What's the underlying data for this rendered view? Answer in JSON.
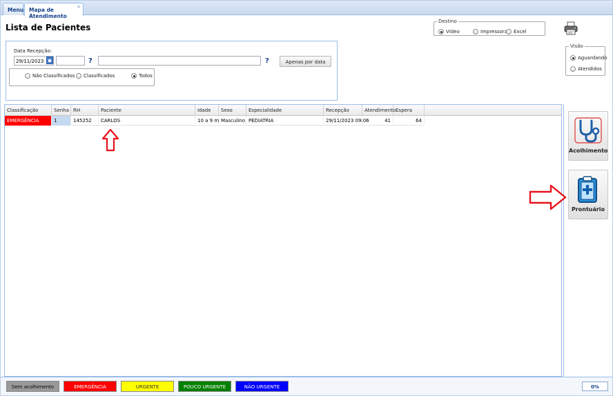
{
  "tabs": [
    {
      "label": "Menu"
    },
    {
      "label": "Mapa de Atendimento",
      "close": "×"
    }
  ],
  "page_title": "Lista de Pacientes",
  "destino": {
    "legend": "Destino",
    "options": [
      "Vídeo",
      "Impressora",
      "Excel"
    ],
    "selected": "Vídeo"
  },
  "filter": {
    "date_label": "Data Recepção:",
    "date_value": "29/11/2023",
    "help1": "?",
    "help2": "?",
    "apenas_button": "Apenas por data",
    "classification_options": [
      "Não Classificados",
      "Classificados",
      "Todos"
    ],
    "classification_selected": "Todos"
  },
  "visao": {
    "legend": "Visão",
    "options": [
      "Aguardando",
      "Atendidos"
    ],
    "selected": "Aguardando"
  },
  "grid": {
    "columns": [
      "Classificação",
      "Senha",
      "RH",
      "Paciente",
      "Idade",
      "Sexo",
      "Especialidade",
      "Recepção",
      "Atendimento",
      "Espera"
    ],
    "rows": [
      {
        "classificacao": "EMERGÊNCIA",
        "senha": "1",
        "rh": "145252",
        "paciente": "CARLOS",
        "idade": "10 a 9 m",
        "sexo": "Masculino",
        "especialidade": "PEDIATRIA",
        "recepcao": "29/11/2023 09:06",
        "atendimento": "41",
        "espera": "64"
      }
    ]
  },
  "side_buttons": {
    "acolhimento": "Acolhimento",
    "prontuario": "Prontuário"
  },
  "legend": [
    {
      "label": "Sem acolhimento",
      "bg": "#9a9a9a",
      "fg": "#000000"
    },
    {
      "label": "EMERGÊNCIA",
      "bg": "#ff0000",
      "fg": "#ffffff"
    },
    {
      "label": "URGENTE",
      "bg": "#ffff00",
      "fg": "#333333"
    },
    {
      "label": "POUCO URGENTE",
      "bg": "#008000",
      "fg": "#ffffff"
    },
    {
      "label": "NÃO URGENTE",
      "bg": "#0000ff",
      "fg": "#ffffff"
    }
  ],
  "progress": "0%",
  "colors": {
    "emergency": "#ff0000",
    "selected_cell": "#c5d9f1",
    "annotation_arrow": "#e8101a",
    "accent": "#15428b"
  }
}
